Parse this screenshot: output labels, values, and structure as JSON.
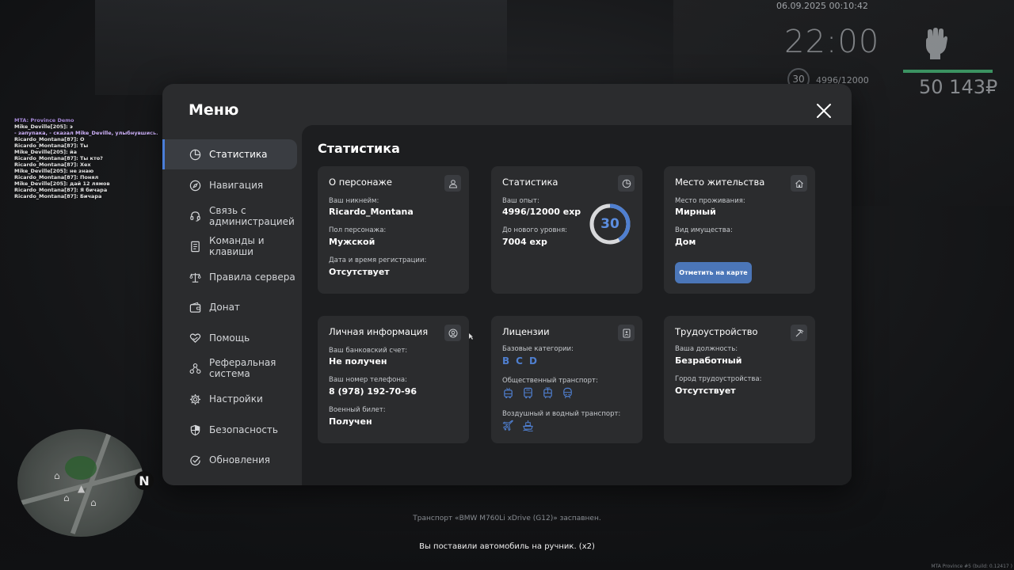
{
  "hud": {
    "date": "06.09.2025 00:10:42",
    "time": "22:00",
    "level": "30",
    "exp": "4996/12000",
    "money": "50 143₽",
    "hp_color": "#3fa069"
  },
  "chat": {
    "lines": [
      "MTA: Province Demo",
      "Mike_Deville[205]: э",
      "- запупака, - сказал Mike_Deville, улыбнувшись.",
      "Ricardo_Montana[87]: О",
      "Ricardo_Montana[87]: Ты",
      "Mike_Deville[205]: йа",
      "Ricardo_Montana[87]: Ты кто?",
      "Ricardo_Montana[87]: Хех",
      "Mike_Deville[205]: не знаю",
      "Ricardo_Montana[87]: Понял",
      "Mike_Deville[205]: дай 12 лямов",
      "Ricardo_Montana[87]: Я бичара",
      "Ricardo_Montana[87]: Бичара"
    ]
  },
  "minimap": {
    "compass": "N"
  },
  "messages": {
    "transport": "Транспорт «BMW M760Li xDrive (G12)» заспавнен.",
    "handbrake": "Вы поставили автомобиль на ручник. (x2)",
    "build": "MTA Province #5 (build: 0.12417 )"
  },
  "menu": {
    "title": "Меню",
    "accent": "#4a7ed8",
    "sidebar": [
      {
        "label": "Статистика",
        "icon": "pie-chart-icon",
        "active": true
      },
      {
        "label": "Навигация",
        "icon": "compass-icon"
      },
      {
        "label": "Связь с администрацией",
        "icon": "headset-icon"
      },
      {
        "label": "Команды и клавиши",
        "icon": "document-icon"
      },
      {
        "label": "Правила сервера",
        "icon": "scales-icon"
      },
      {
        "label": "Донат",
        "icon": "wallet-icon"
      },
      {
        "label": "Помощь",
        "icon": "heart-hands-icon"
      },
      {
        "label": "Реферальная система",
        "icon": "network-icon"
      },
      {
        "label": "Настройки",
        "icon": "gear-icon"
      },
      {
        "label": "Безопасность",
        "icon": "shield-icon"
      },
      {
        "label": "Обновления",
        "icon": "check-circle-icon"
      }
    ],
    "content_title": "Статистика",
    "cards": {
      "character": {
        "title": "О персонаже",
        "nick_label": "Ваш никнейм:",
        "nick": "Ricardo_Montana",
        "gender_label": "Пол персонажа:",
        "gender": "Мужской",
        "reg_label": "Дата и время регистрации:",
        "reg": "Отсутствует"
      },
      "stats": {
        "title": "Статистика",
        "exp_label": "Ваш опыт:",
        "exp": "4996/12000 exp",
        "next_label": "До нового уровня:",
        "next": "7004 exp",
        "level": "30",
        "progress": 0.416
      },
      "residence": {
        "title": "Место жительства",
        "place_label": "Место проживания:",
        "place": "Мирный",
        "property_label": "Вид имущества:",
        "property": "Дом",
        "button": "Отметить на карте"
      },
      "personal": {
        "title": "Личная информация",
        "bank_label": "Ваш банковский счет:",
        "bank": "Не получен",
        "phone_label": "Ваш номер телефона:",
        "phone": "8 (978) 192-70-96",
        "military_label": "Военный билет:",
        "military": "Получен"
      },
      "licenses": {
        "title": "Лицензии",
        "base_label": "Базовые категории:",
        "categories": [
          "B",
          "C",
          "D"
        ],
        "public_label": "Общественный транспорт:",
        "public_icons": [
          "trolleybus-icon",
          "bus-icon",
          "tram-icon",
          "metro-icon"
        ],
        "air_label": "Воздушный и водный транспорт:",
        "air_icons": [
          "plane-icon",
          "boat-icon"
        ]
      },
      "employment": {
        "title": "Трудоустройство",
        "position_label": "Ваша должность:",
        "position": "Безработный",
        "city_label": "Город трудоустройства:",
        "city": "Отсутствует"
      }
    }
  }
}
